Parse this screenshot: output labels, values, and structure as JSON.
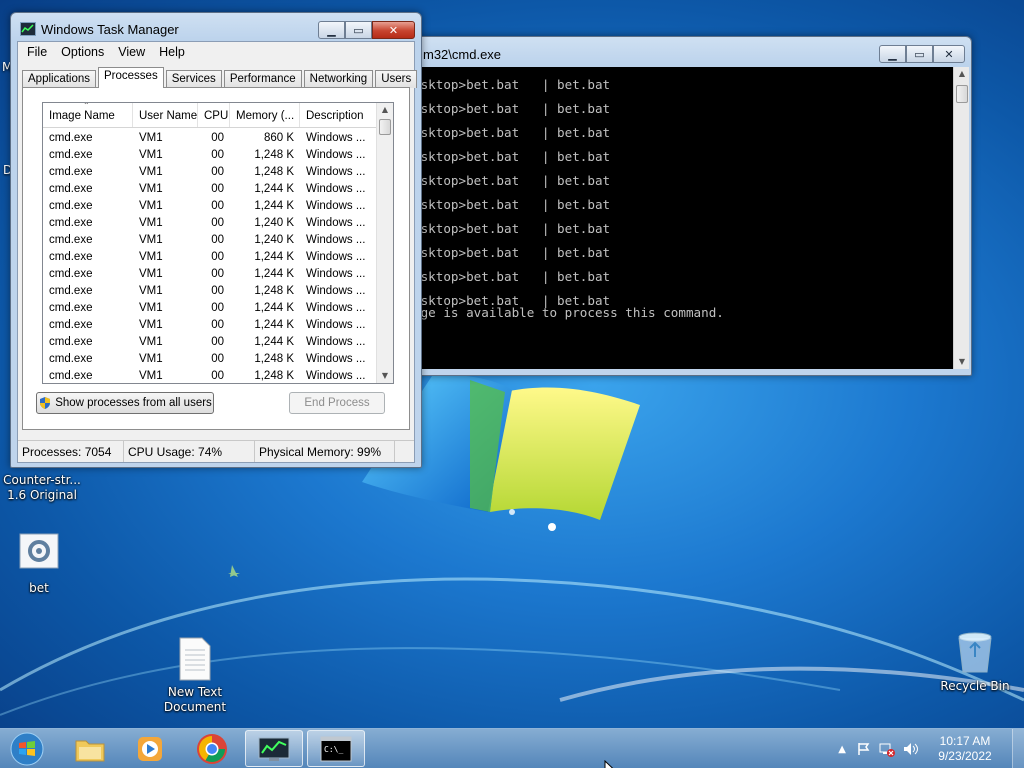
{
  "desktop": {
    "icons": [
      {
        "id": "counter-strike",
        "label": "Counter-str...\n1.6 Original"
      },
      {
        "id": "bet",
        "label": "bet"
      },
      {
        "id": "new-text",
        "label": "New Text\nDocument"
      },
      {
        "id": "recycle-bin",
        "label": "Recycle Bin"
      }
    ],
    "edge_letters": [
      "M",
      "D"
    ]
  },
  "cmd_window": {
    "title": "m32\\cmd.exe",
    "lines": [
      "esktop>bet.bat   | bet.bat",
      "",
      "esktop>bet.bat   | bet.bat",
      "",
      "esktop>bet.bat   | bet.bat",
      "",
      "esktop>bet.bat   | bet.bat",
      "",
      "esktop>bet.bat   | bet.bat",
      "",
      "esktop>bet.bat   | bet.bat",
      "",
      "esktop>bet.bat   | bet.bat",
      "",
      "esktop>bet.bat   | bet.bat",
      "",
      "esktop>bet.bat   | bet.bat",
      "",
      "esktop>bet.bat   | bet.bat",
      "age is available to process this command."
    ]
  },
  "task_manager": {
    "title": "Windows Task Manager",
    "menu": [
      "File",
      "Options",
      "View",
      "Help"
    ],
    "tabs": [
      "Applications",
      "Processes",
      "Services",
      "Performance",
      "Networking",
      "Users"
    ],
    "active_tab": "Processes",
    "columns": [
      "Image Name",
      "User Name",
      "CPU",
      "Memory (...",
      "Description"
    ],
    "rows": [
      [
        "cmd.exe",
        "VM1",
        "00",
        "860 K",
        "Windows ..."
      ],
      [
        "cmd.exe",
        "VM1",
        "00",
        "1,248 K",
        "Windows ..."
      ],
      [
        "cmd.exe",
        "VM1",
        "00",
        "1,248 K",
        "Windows ..."
      ],
      [
        "cmd.exe",
        "VM1",
        "00",
        "1,244 K",
        "Windows ..."
      ],
      [
        "cmd.exe",
        "VM1",
        "00",
        "1,244 K",
        "Windows ..."
      ],
      [
        "cmd.exe",
        "VM1",
        "00",
        "1,240 K",
        "Windows ..."
      ],
      [
        "cmd.exe",
        "VM1",
        "00",
        "1,240 K",
        "Windows ..."
      ],
      [
        "cmd.exe",
        "VM1",
        "00",
        "1,244 K",
        "Windows ..."
      ],
      [
        "cmd.exe",
        "VM1",
        "00",
        "1,244 K",
        "Windows ..."
      ],
      [
        "cmd.exe",
        "VM1",
        "00",
        "1,248 K",
        "Windows ..."
      ],
      [
        "cmd.exe",
        "VM1",
        "00",
        "1,244 K",
        "Windows ..."
      ],
      [
        "cmd.exe",
        "VM1",
        "00",
        "1,244 K",
        "Windows ..."
      ],
      [
        "cmd.exe",
        "VM1",
        "00",
        "1,244 K",
        "Windows ..."
      ],
      [
        "cmd.exe",
        "VM1",
        "00",
        "1,248 K",
        "Windows ..."
      ],
      [
        "cmd.exe",
        "VM1",
        "00",
        "1,248 K",
        "Windows ..."
      ]
    ],
    "show_all_button": "Show processes from all users",
    "end_process_button": "End Process",
    "status": {
      "processes": "Processes: 7054",
      "cpu": "CPU Usage: 74%",
      "memory": "Physical Memory: 99%"
    }
  },
  "taskbar": {
    "time": "10:17 AM",
    "date": "9/23/2022",
    "tray_arrow": "▲"
  },
  "colors": {
    "accent": "#1c78cf",
    "close_button": "#c7442f",
    "console_bg": "#000000",
    "console_fg": "#c0c0c0"
  }
}
